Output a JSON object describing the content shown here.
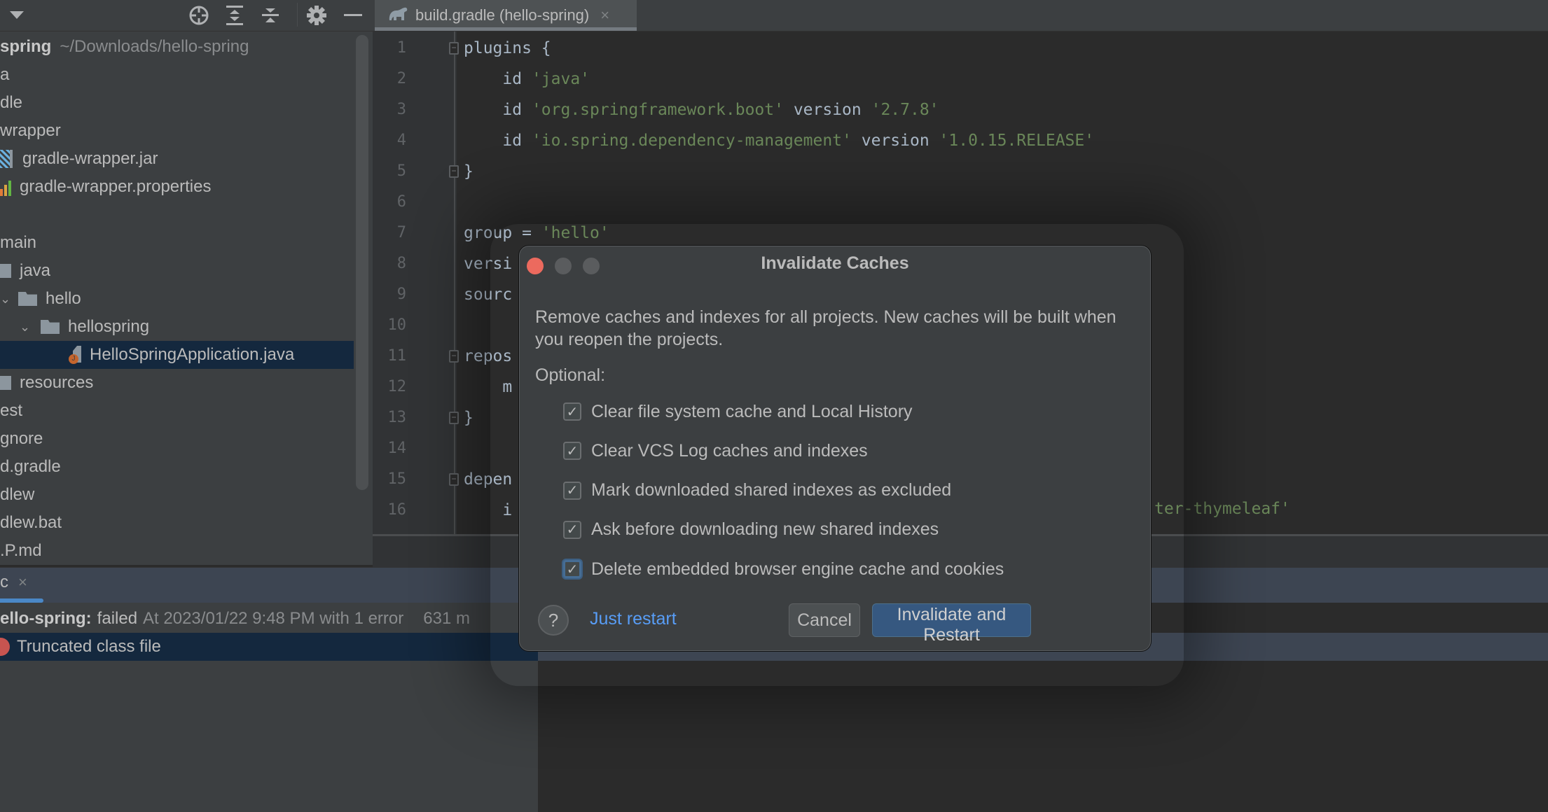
{
  "toolbar": {
    "icons": [
      "dropdown-arrow-icon",
      "locate-icon",
      "expand-all-icon",
      "collapse-all-icon",
      "gear-icon",
      "minimize-icon"
    ]
  },
  "editor_tab": {
    "label": "build.gradle (hello-spring)",
    "icon": "gradle-elephant-icon",
    "close": "×"
  },
  "project_tree": {
    "root_name": "spring",
    "root_path": "~/Downloads/hello-spring",
    "rows": [
      {
        "label": "a",
        "icon": "none"
      },
      {
        "label": "dle",
        "icon": "none"
      },
      {
        "label": "wrapper",
        "icon": "none"
      },
      {
        "label": "gradle-wrapper.jar",
        "icon": "archive-icon"
      },
      {
        "label": "gradle-wrapper.properties",
        "icon": "properties-icon"
      },
      {
        "label": "",
        "icon": "none"
      },
      {
        "label": "main",
        "icon": "none"
      },
      {
        "label": "java",
        "icon": "folder-icon"
      },
      {
        "label": "hello",
        "icon": "folder-icon"
      },
      {
        "label": "hellospring",
        "icon": "folder-icon"
      },
      {
        "label": "HelloSpringApplication.java",
        "icon": "java-class-icon",
        "selected": true
      },
      {
        "label": "resources",
        "icon": "folder-icon"
      },
      {
        "label": "est",
        "icon": "none"
      },
      {
        "label": "gnore",
        "icon": "none"
      },
      {
        "label": "d.gradle",
        "icon": "none"
      },
      {
        "label": "dlew",
        "icon": "none"
      },
      {
        "label": "dlew.bat",
        "icon": "none"
      },
      {
        "label": ".P.md",
        "icon": "none"
      }
    ]
  },
  "editor": {
    "lines": [
      {
        "n": "1",
        "parts": [
          [
            "k",
            "plugins {"
          ]
        ],
        "fold": "open"
      },
      {
        "n": "2",
        "parts": [
          [
            "k",
            "    id "
          ],
          [
            "s",
            "'java'"
          ]
        ]
      },
      {
        "n": "3",
        "parts": [
          [
            "k",
            "    id "
          ],
          [
            "s",
            "'org.springframework.boot'"
          ],
          [
            "k",
            " version "
          ],
          [
            "s",
            "'2.7.8'"
          ]
        ]
      },
      {
        "n": "4",
        "parts": [
          [
            "k",
            "    id "
          ],
          [
            "s",
            "'io.spring.dependency-management'"
          ],
          [
            "k",
            " version "
          ],
          [
            "s",
            "'1.0.15.RELEASE'"
          ]
        ]
      },
      {
        "n": "5",
        "parts": [
          [
            "k",
            "}"
          ]
        ],
        "fold": "close"
      },
      {
        "n": "6",
        "parts": []
      },
      {
        "n": "7",
        "parts": [
          [
            "k",
            "group = "
          ],
          [
            "s",
            "'hello'"
          ]
        ]
      },
      {
        "n": "8",
        "parts": [
          [
            "k",
            "versi"
          ]
        ]
      },
      {
        "n": "9",
        "parts": [
          [
            "k",
            "sourc"
          ]
        ]
      },
      {
        "n": "10",
        "parts": []
      },
      {
        "n": "11",
        "parts": [
          [
            "k",
            "repos"
          ]
        ],
        "fold": "open"
      },
      {
        "n": "12",
        "parts": [
          [
            "k",
            "    m"
          ]
        ]
      },
      {
        "n": "13",
        "parts": [
          [
            "k",
            "}"
          ]
        ],
        "fold": "close"
      },
      {
        "n": "14",
        "parts": []
      },
      {
        "n": "15",
        "parts": [
          [
            "k",
            "depen"
          ]
        ],
        "fold": "open"
      },
      {
        "n": "16",
        "parts": [
          [
            "k",
            "    i"
          ]
        ]
      }
    ],
    "line16_tail": "ter-thymeleaf'"
  },
  "build_panel": {
    "tab_label": "c",
    "tab_close": "×",
    "status_project": "ello-spring:",
    "status_result": "failed",
    "status_detail": "At 2023/01/22 9:48 PM with 1 error",
    "status_time": "631 m",
    "error_message": "Truncated class file"
  },
  "dialog": {
    "title": "Invalidate Caches",
    "description": "Remove caches and indexes for all projects. New caches will be built when you reopen the projects.",
    "optional_label": "Optional:",
    "options": [
      {
        "label": "Clear file system cache and Local History",
        "checked": true
      },
      {
        "label": "Clear VCS Log caches and indexes",
        "checked": true
      },
      {
        "label": "Mark downloaded shared indexes as excluded",
        "checked": true
      },
      {
        "label": "Ask before downloading new shared indexes",
        "checked": true
      },
      {
        "label": "Delete embedded browser engine cache and cookies",
        "checked": true,
        "focused": true
      }
    ],
    "help_label": "?",
    "just_restart_label": "Just restart",
    "cancel_label": "Cancel",
    "ok_label": "Invalidate and Restart",
    "traffic_colors": {
      "close": "#ec6a5e",
      "minimize": "#5a5c5e",
      "zoom": "#5a5c5e"
    }
  },
  "colors": {
    "accent": "#365880",
    "link": "#589df6",
    "string": "#6a8759",
    "keyword": "#a9b7c6",
    "selection": "#14283e",
    "error": "#c75450"
  }
}
